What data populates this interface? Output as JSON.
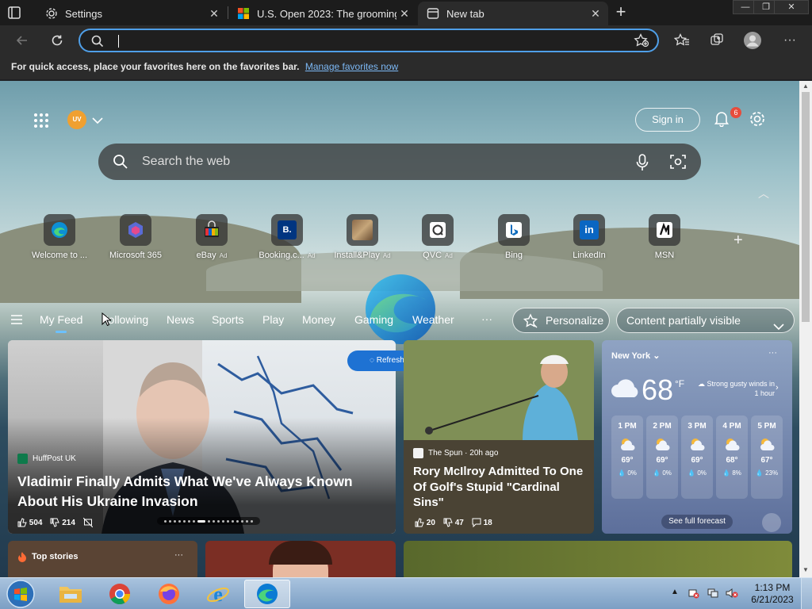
{
  "tabs": [
    {
      "title": "Settings",
      "icon": "gear-icon"
    },
    {
      "title": "U.S. Open 2023: The grooming r",
      "icon": "microsoft-logo-icon"
    },
    {
      "title": "New tab",
      "icon": "newtab-page-icon"
    }
  ],
  "window_controls": {
    "minimize": "—",
    "restore": "❐",
    "close": "✕"
  },
  "address_bar": {
    "value": "",
    "placeholder": ""
  },
  "favorites_bar": {
    "message": "For quick access, place your favorites here on the favorites bar.",
    "link": "Manage favorites now"
  },
  "header": {
    "avatar_initials": "UV",
    "sign_in": "Sign in",
    "notification_count": "6"
  },
  "search": {
    "placeholder": "Search the web"
  },
  "quick_links": [
    {
      "label": "Welcome to ...",
      "ad": "",
      "icon": "edge-icon"
    },
    {
      "label": "Microsoft 365",
      "ad": "",
      "icon": "microsoft365-icon"
    },
    {
      "label": "eBay",
      "ad": "Ad",
      "icon": "ebay-icon"
    },
    {
      "label": "Booking.c...",
      "ad": "Ad",
      "icon": "booking-icon"
    },
    {
      "label": "Install&Play",
      "ad": "Ad",
      "icon": "install-play-icon"
    },
    {
      "label": "QVC",
      "ad": "Ad",
      "icon": "qvc-icon"
    },
    {
      "label": "Bing",
      "ad": "",
      "icon": "bing-icon"
    },
    {
      "label": "LinkedIn",
      "ad": "",
      "icon": "linkedin-icon"
    },
    {
      "label": "MSN",
      "ad": "",
      "icon": "msn-icon"
    }
  ],
  "feed_nav": {
    "tabs": [
      "My Feed",
      "Following",
      "News",
      "Sports",
      "Play",
      "Money",
      "Gaming",
      "Weather"
    ],
    "more": "···",
    "personalize": "Personalize",
    "content_visibility": "Content partially visible"
  },
  "refresh_stories": "Refresh stories",
  "main_story": {
    "source": "HuffPost UK",
    "headline": "Vladimir Finally Admits What We've Always Known About His Ukraine Invasion",
    "likes": "504",
    "dislikes": "214"
  },
  "golf_story": {
    "source": "The Spun · 20h ago",
    "headline": "Rory McIlroy Admitted To One Of Golf's Stupid \"Cardinal Sins\"",
    "likes": "20",
    "dislikes": "47",
    "comments": "18"
  },
  "weather": {
    "location": "New York",
    "temperature": "68",
    "unit": "°F",
    "alert": "Strong gusty winds in 1 hour",
    "hours": [
      {
        "time": "1 PM",
        "temp": "69°",
        "precip": "0%"
      },
      {
        "time": "2 PM",
        "temp": "69°",
        "precip": "0%"
      },
      {
        "time": "3 PM",
        "temp": "69°",
        "precip": "0%"
      },
      {
        "time": "4 PM",
        "temp": "68°",
        "precip": "8%"
      },
      {
        "time": "5 PM",
        "temp": "67°",
        "precip": "23%"
      }
    ],
    "forecast_link": "See full forecast"
  },
  "top_stories": {
    "label": "Top stories"
  },
  "taskbar": {
    "time": "1:13 PM",
    "date": "6/21/2023"
  },
  "colors": {
    "accent": "#4f9fe8",
    "refresh_button": "#1e72d3",
    "badge": "#e74c3c"
  }
}
